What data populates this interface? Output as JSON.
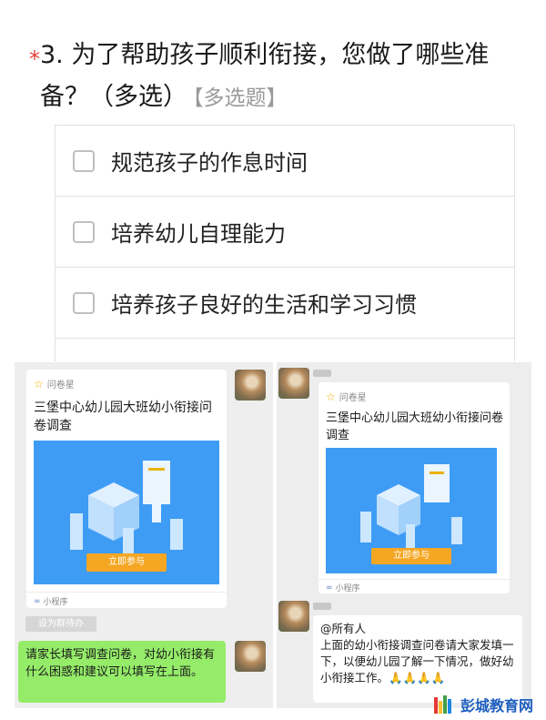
{
  "question": {
    "required_mark": "*",
    "text": "3. 为了帮助孩子顺利衔接，您做了哪些准备？（多选）",
    "type_tag": "【多选题】",
    "options": [
      "规范孩子的作息时间",
      "培养幼儿自理能力",
      "培养孩子良好的生活和学习习惯"
    ]
  },
  "left_chat": {
    "card": {
      "brand": "问卷星",
      "title": "三堡中心幼儿园大班幼小衔接问卷调查",
      "button": "立即参与",
      "footer": "小程序"
    },
    "todo_button": "设为群待办",
    "message": "请家长填写调查问卷，对幼小衔接有什么困惑和建议可以填写在上面。"
  },
  "right_chat": {
    "card": {
      "brand": "问卷星",
      "title": "三堡中心幼儿园大班幼小衔接问卷调查",
      "button": "立即参与",
      "footer": "小程序"
    },
    "message": "@所有人\n上面的幼小衔接调查问卷请大家发填一下，以便幼儿园了解一下情况，做好幼小衔接工作。🙏🙏🙏🙏"
  },
  "watermark": {
    "text": "彭城教育网"
  },
  "colors": {
    "accent_orange": "#f5a623",
    "banner_blue": "#3e9cf5",
    "chat_green": "#95ec69",
    "required_red": "#e5423a"
  }
}
